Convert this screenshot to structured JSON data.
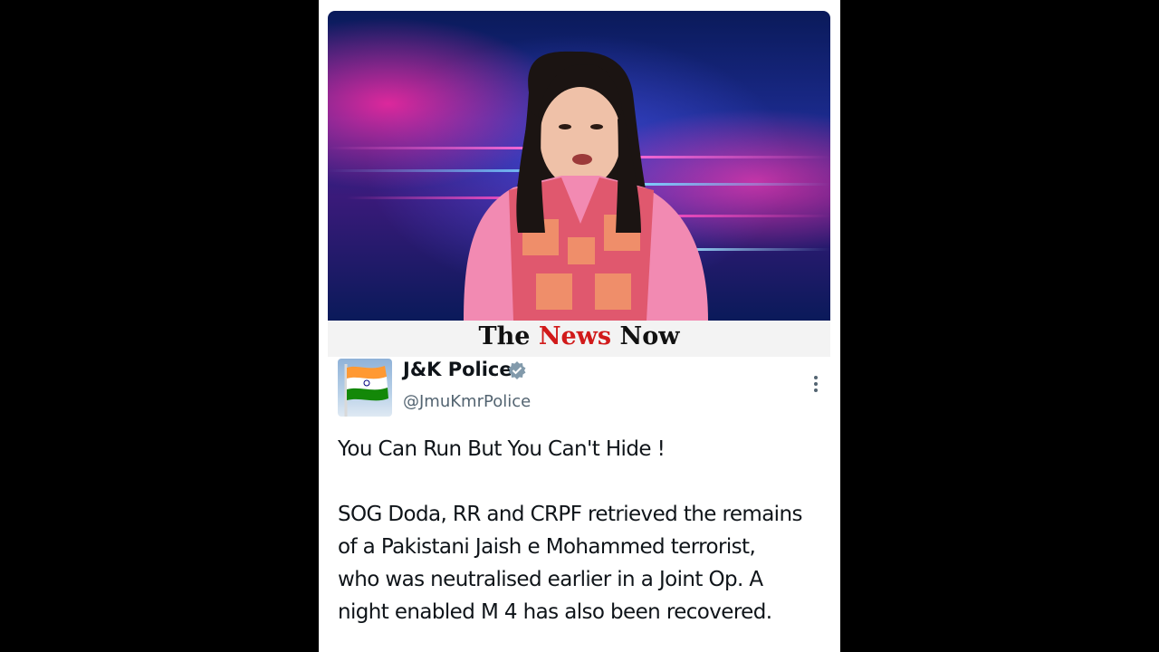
{
  "video": {
    "description_icon": "news-presenter-figure"
  },
  "brand": {
    "word1": "The",
    "word2": "News",
    "word3": "Now",
    "accent_color": "#d11a1a"
  },
  "tweet": {
    "avatar_icon": "indian-flag-icon",
    "author_name": "J&K Police",
    "verified_icon": "verified-badge-icon",
    "handle": "@JmuKmrPolice",
    "more_icon": "more-options-icon",
    "headline": "You Can Run But You Can't Hide !",
    "body": [
      "SOG Doda, RR and CRPF retrieved the remains",
      "of a Pakistani Jaish e Mohammed terrorist,",
      "who was neutralised earlier in a Joint Op. A",
      "night enabled M 4 has also been recovered."
    ]
  }
}
